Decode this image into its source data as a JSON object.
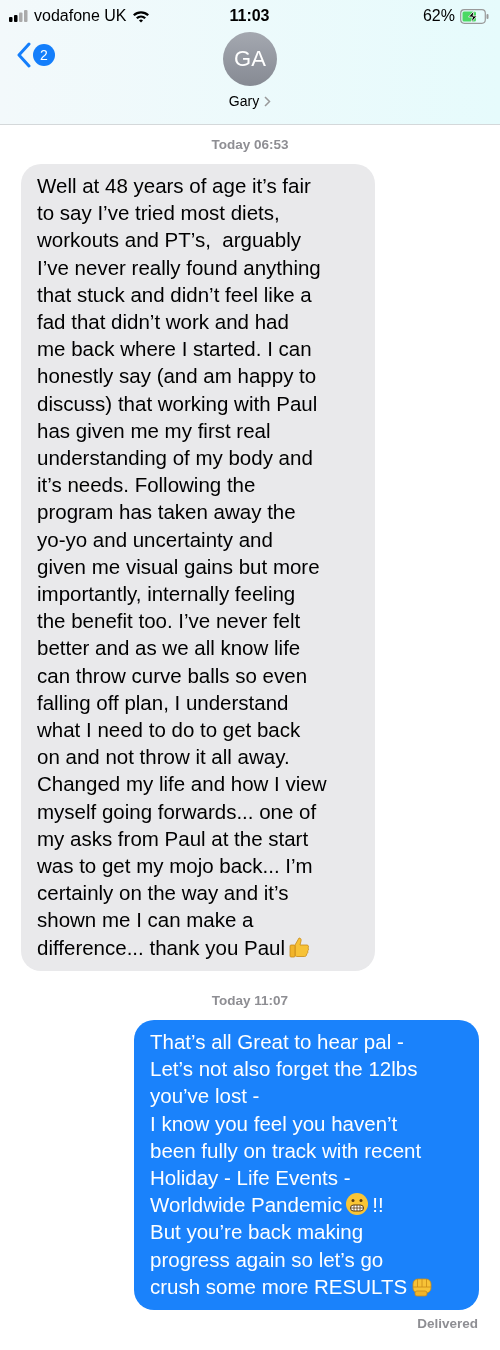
{
  "status_bar": {
    "carrier": "vodafone UK",
    "time": "11:03",
    "battery": "62%"
  },
  "header": {
    "unread_count": "2",
    "avatar_initials": "GA",
    "contact_name": "Gary"
  },
  "messages": [
    {
      "kind": "timestamp",
      "text": "Today 06:53"
    },
    {
      "kind": "incoming",
      "parts": [
        {
          "kind": "text",
          "text": "Well at 48 years of age it’s fair\nto say I’ve tried most diets,\nworkouts and PT’s,  arguably\nI’ve never really found anything\nthat stuck and didn’t feel like a\nfad that didn’t work and had\nme back where I started. I can\nhonestly say (and am happy to\ndiscuss) that working with Paul\nhas given me my first real\nunderstanding of my body and\nit’s needs. Following the\nprogram has taken away the\nyo-yo and uncertainty and\ngiven me visual gains but more\nimportantly, internally feeling\nthe benefit too. I’ve never felt\nbetter and as we all know life\ncan throw curve balls so even\nfalling off plan, I understand\nwhat I need to do to get back\non and not throw it all away.\nChanged my life and how I view\nmyself going forwards... one of\nmy asks from Paul at the start\nwas to get my mojo back... I’m\ncertainly on the way and it’s\nshown me I can make a\ndifference... thank you Paul"
        },
        {
          "kind": "thumbs-up"
        }
      ]
    },
    {
      "kind": "timestamp",
      "text": "Today 11:07"
    },
    {
      "kind": "outgoing",
      "parts": [
        {
          "kind": "text",
          "text": "That’s all Great to hear pal -\nLet’s not also forget the 12lbs\nyou’ve lost -\nI know you feel you haven’t\nbeen fully on track with recent\nHoliday - Life Events -\nWorldwide Pandemic"
        },
        {
          "kind": "grimace"
        },
        {
          "kind": "text",
          "text": "!!\nBut you’re back making\nprogress again so let’s go\ncrush some more RESULTS"
        },
        {
          "kind": "fist"
        }
      ]
    },
    {
      "kind": "receipt",
      "text": "Delivered"
    }
  ]
}
